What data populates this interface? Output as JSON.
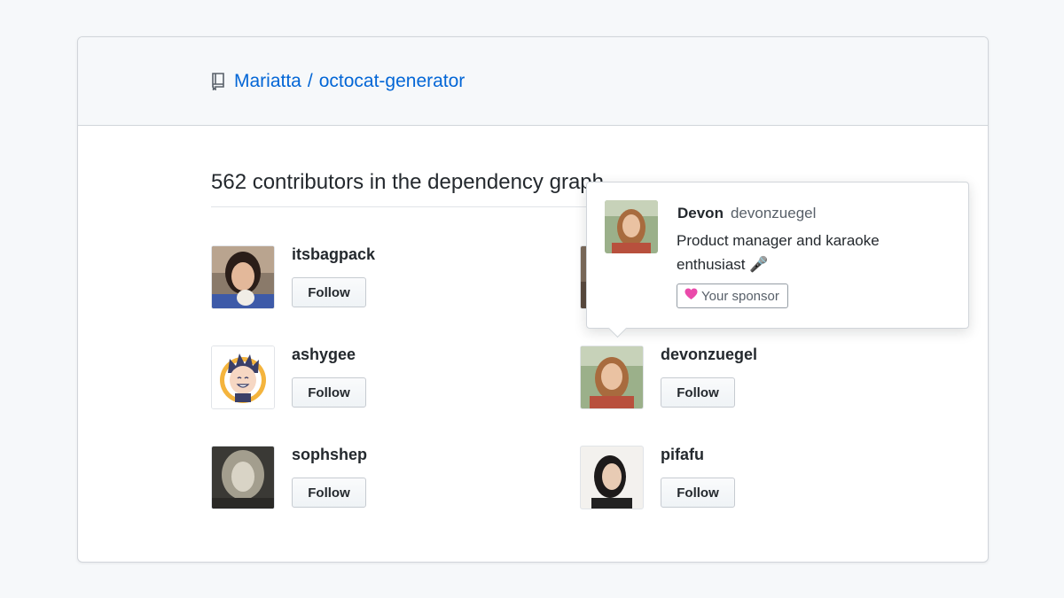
{
  "repo": {
    "owner": "Mariatta",
    "separator": "/",
    "name": "octocat-generator",
    "icon": "repo-icon"
  },
  "heading": "562 contributors in the dependency graph",
  "contributors": [
    {
      "username": "itsbagpack",
      "follow_label": "Follow"
    },
    {
      "username": "",
      "follow_label": ""
    },
    {
      "username": "ashygee",
      "follow_label": "Follow"
    },
    {
      "username": "devonzuegel",
      "follow_label": "Follow"
    },
    {
      "username": "sophshep",
      "follow_label": "Follow"
    },
    {
      "username": "pifafu",
      "follow_label": "Follow"
    }
  ],
  "popover": {
    "display_name": "Devon",
    "login": "devonzuegel",
    "bio": "Product manager and karaoke enthusiast 🎤",
    "badge_icon": "heart-icon",
    "badge_label": "Your sponsor"
  },
  "colors": {
    "link": "#0366d6",
    "sponsor_heart": "#ea4aaa"
  }
}
